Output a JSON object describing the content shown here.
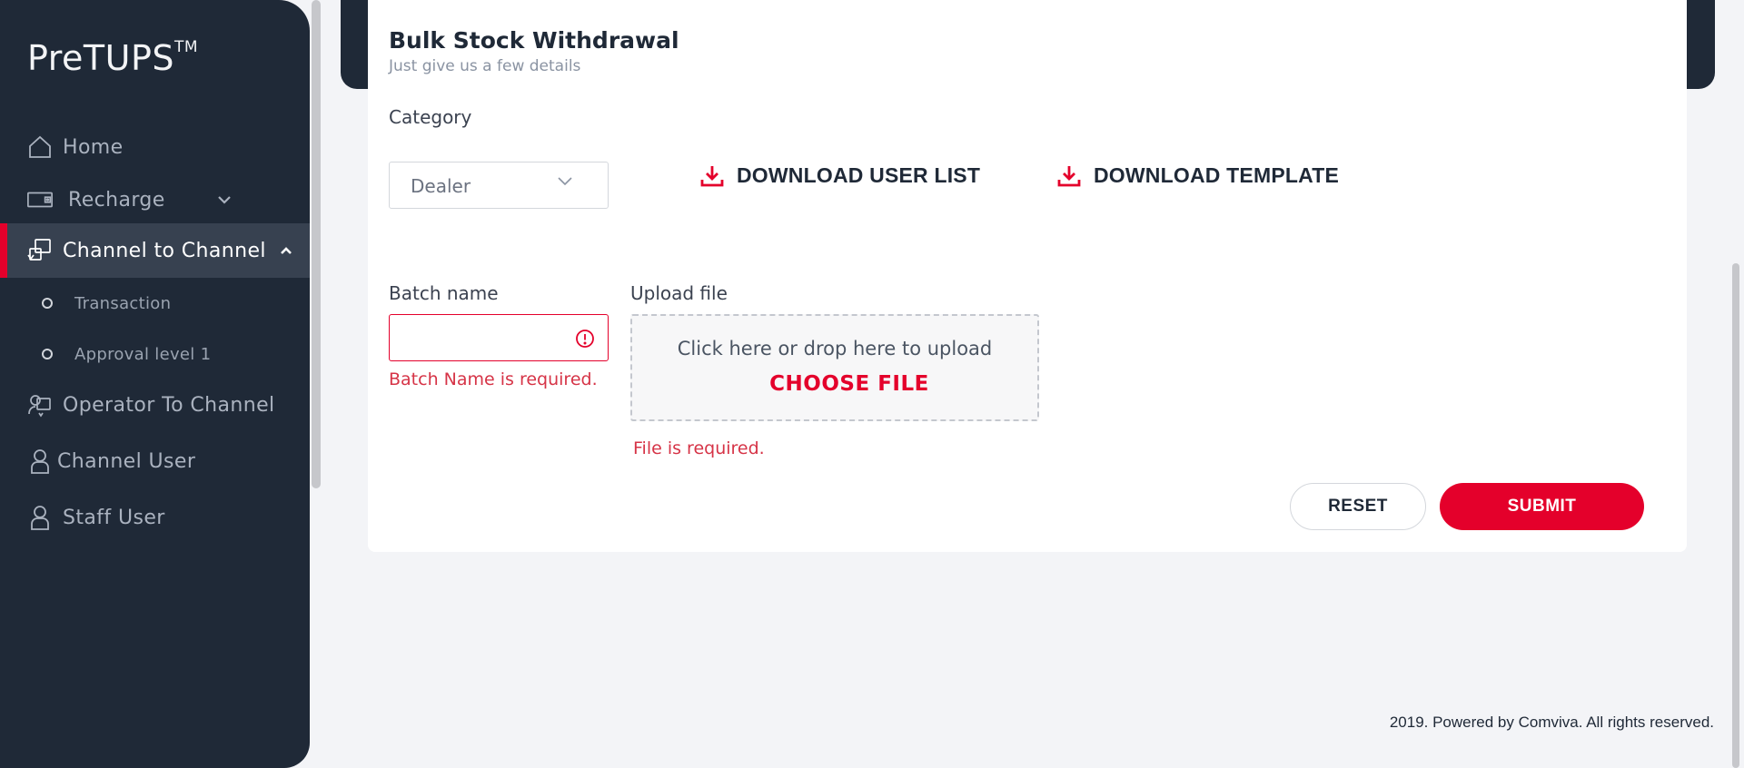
{
  "app": {
    "logo_text": "PreTUPS",
    "logo_mark": "TM"
  },
  "sidebar": {
    "items": [
      {
        "label": "Home",
        "icon": "home-icon"
      },
      {
        "label": "Recharge",
        "icon": "recharge-icon"
      },
      {
        "label": "Channel to Channel",
        "icon": "channel-transfer-icon",
        "expanded": true
      },
      {
        "label": "Operator To Channel",
        "icon": "operator-icon"
      },
      {
        "label": "Channel User",
        "icon": "user-icon"
      },
      {
        "label": "Staff User",
        "icon": "user-icon"
      }
    ],
    "sub_items": [
      {
        "label": "Transaction"
      },
      {
        "label": "Approval level 1"
      }
    ]
  },
  "page": {
    "title": "Bulk Stock Withdrawal",
    "subtitle": "Just give us a few details"
  },
  "form": {
    "category_label": "Category",
    "category_value": "Dealer",
    "download_user_list": "DOWNLOAD USER LIST",
    "download_template": "DOWNLOAD TEMPLATE",
    "batch_label": "Batch name",
    "batch_value": "",
    "batch_error": "Batch Name is required.",
    "upload_label": "Upload file",
    "upload_hint": "Click here or drop here to upload",
    "choose_file": "CHOOSE FILE",
    "file_error": "File is required.",
    "reset": "RESET",
    "submit": "SUBMIT"
  },
  "footer": {
    "text": "2019. Powered by Comviva. All rights reserved."
  },
  "colors": {
    "accent": "#e4002b",
    "sidebar_bg": "#1f2937",
    "error": "#d63447"
  }
}
